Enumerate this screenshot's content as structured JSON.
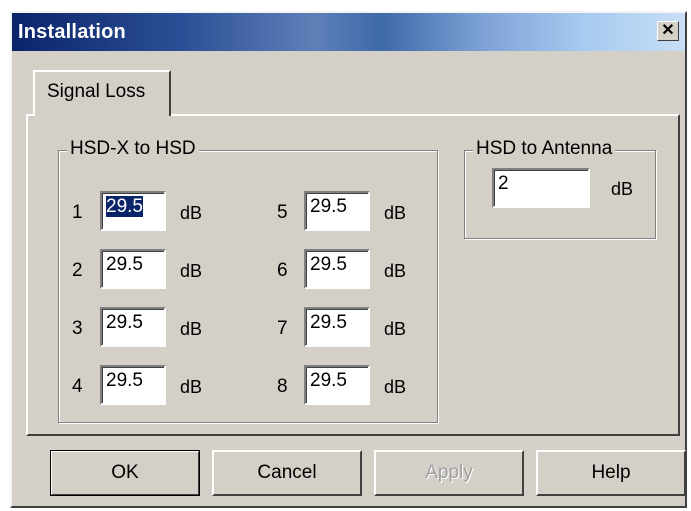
{
  "window": {
    "title": "Installation",
    "close_glyph": "✕",
    "title_color": "#0a246a"
  },
  "tabs": [
    {
      "label": "Signal Loss",
      "active": true
    }
  ],
  "hsdx_group": {
    "legend": "HSD-X to HSD",
    "rows": [
      {
        "index": "1",
        "value": "29.5",
        "unit": "dB"
      },
      {
        "index": "2",
        "value": "29.5",
        "unit": "dB"
      },
      {
        "index": "3",
        "value": "29.5",
        "unit": "dB"
      },
      {
        "index": "4",
        "value": "29.5",
        "unit": "dB"
      },
      {
        "index": "5",
        "value": "29.5",
        "unit": "dB"
      },
      {
        "index": "6",
        "value": "29.5",
        "unit": "dB"
      },
      {
        "index": "7",
        "value": "29.5",
        "unit": "dB"
      },
      {
        "index": "8",
        "value": "29.5",
        "unit": "dB"
      }
    ]
  },
  "antenna_group": {
    "legend": "HSD to Antenna",
    "value": "2",
    "unit": "dB"
  },
  "buttons": {
    "ok": "OK",
    "cancel": "Cancel",
    "apply": "Apply",
    "help": "Help"
  }
}
